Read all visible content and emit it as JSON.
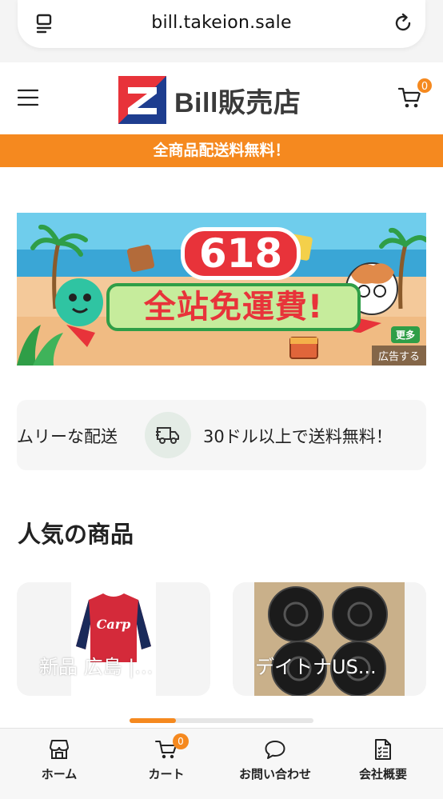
{
  "browser": {
    "url": "bill.takeion.sale"
  },
  "header": {
    "logo_text": "Bill販売店",
    "cart_count": "0"
  },
  "promo_strip": {
    "text": "全商品配送料無料！"
  },
  "banner": {
    "number": "618",
    "headline": "全站免運費!",
    "more_label": "更多",
    "ad_label": "広告する"
  },
  "shipping_info": {
    "left_text": "ムリーな配送",
    "right_text": "30ドル以上で送料無料！"
  },
  "popular": {
    "title": "人気の商品",
    "products": [
      {
        "title": "新品 広島 |..."
      },
      {
        "title": "デイトナUS..."
      }
    ]
  },
  "carousel": {
    "active_fraction": 0.25
  },
  "bottom_nav": {
    "items": [
      {
        "label": "ホーム",
        "icon": "store-icon"
      },
      {
        "label": "カート",
        "icon": "cart-icon",
        "badge": "0"
      },
      {
        "label": "お問い合わせ",
        "icon": "chat-icon"
      },
      {
        "label": "会社概要",
        "icon": "document-icon"
      }
    ]
  },
  "colors": {
    "accent": "#f5891f",
    "text": "#222222"
  }
}
